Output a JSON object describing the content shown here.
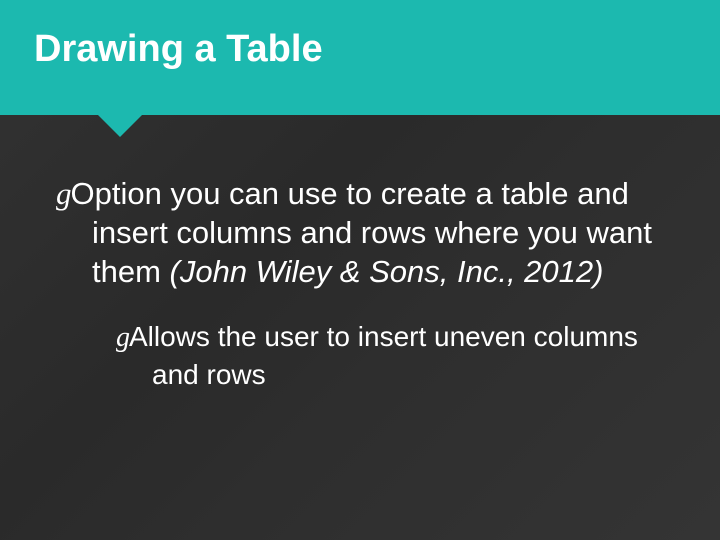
{
  "header": {
    "title": "Drawing a Table"
  },
  "bullets": {
    "main": {
      "glyph": "g",
      "text_prefix": "Option you can use to create a table and insert columns and rows where you want them ",
      "citation": "(John Wiley & Sons, Inc., 2012)"
    },
    "sub": {
      "glyph": "g",
      "text": "Allows the user to insert uneven columns and rows"
    }
  }
}
